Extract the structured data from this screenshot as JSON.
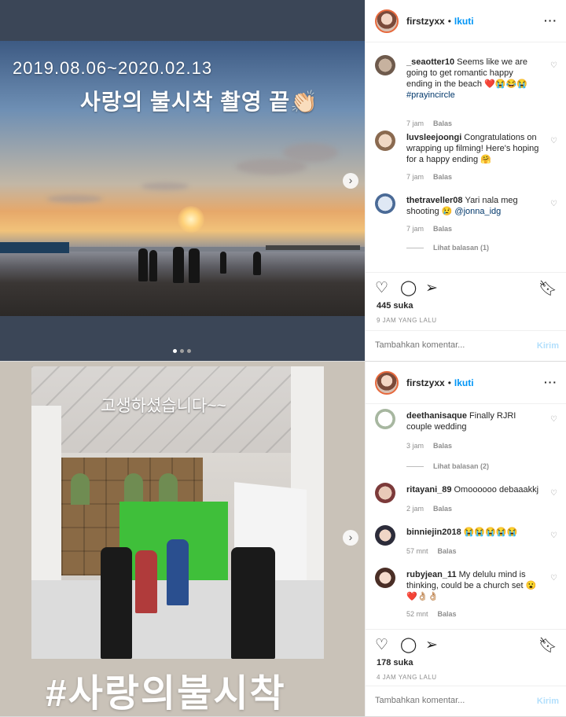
{
  "post1": {
    "overlay_dates": "2019.08.06~2020.02.13",
    "overlay_title": "사랑의 불시착 촬영 끝👏🏻",
    "next_icon": "chevron-right-icon",
    "header": {
      "username": "firstzyxx",
      "bullet": "•",
      "follow": "Ikuti",
      "more": "···"
    },
    "comments": [
      {
        "user": "_seaotter10",
        "text": "Seems like we are going to get romantic happy ending in the beach ❤️😭😂😭",
        "tag": "#prayincircle",
        "time": "7 jam",
        "reply": "Balas"
      },
      {
        "user": "luvsleejoongi",
        "text": "Congratulations on wrapping up filming! Here's hoping for a happy ending 🤗",
        "time": "7 jam",
        "reply": "Balas"
      },
      {
        "user": "thetraveller08",
        "text": "Yari nala meg shooting 😢",
        "tag": "@jonna_idg",
        "time": "7 jam",
        "reply": "Balas",
        "view_replies": "Lihat balasan (1)"
      }
    ],
    "likes": "445 suka",
    "timestamp": "9 JAM YANG LALU",
    "add_comment_placeholder": "Tambahkan komentar...",
    "post_label": "Kirim"
  },
  "post2": {
    "overlay_top": "고생하셨습니다~~",
    "overlay_bottom": "#사랑의불시착",
    "next_icon": "chevron-right-icon",
    "header": {
      "username": "firstzyxx",
      "bullet": "•",
      "follow": "Ikuti",
      "more": "···"
    },
    "comments": [
      {
        "user": "deethanisaque",
        "text": "Finally RJRI couple wedding",
        "time": "3 jam",
        "reply": "Balas",
        "view_replies": "Lihat balasan (2)"
      },
      {
        "user": "ritayani_89",
        "text": "Omoooooo debaaakkj",
        "time": "2 jam",
        "reply": "Balas"
      },
      {
        "user": "binniejin2018",
        "text": "😭😭😭😭😭",
        "time": "57 mnt",
        "reply": "Balas"
      },
      {
        "user": "rubyjean_11",
        "text": "My delulu mind is thinking, could be a church set 😮❤️👌🏼👌🏼",
        "time": "52 mnt",
        "reply": "Balas"
      }
    ],
    "likes": "178 suka",
    "timestamp": "4 JAM YANG LALU",
    "add_comment_placeholder": "Tambahkan komentar...",
    "post_label": "Kirim"
  },
  "icons": {
    "like": "heart-icon",
    "comment": "speech-bubble-icon",
    "share": "paper-plane-icon",
    "save": "bookmark-icon",
    "comment_like": "small-heart-icon"
  }
}
